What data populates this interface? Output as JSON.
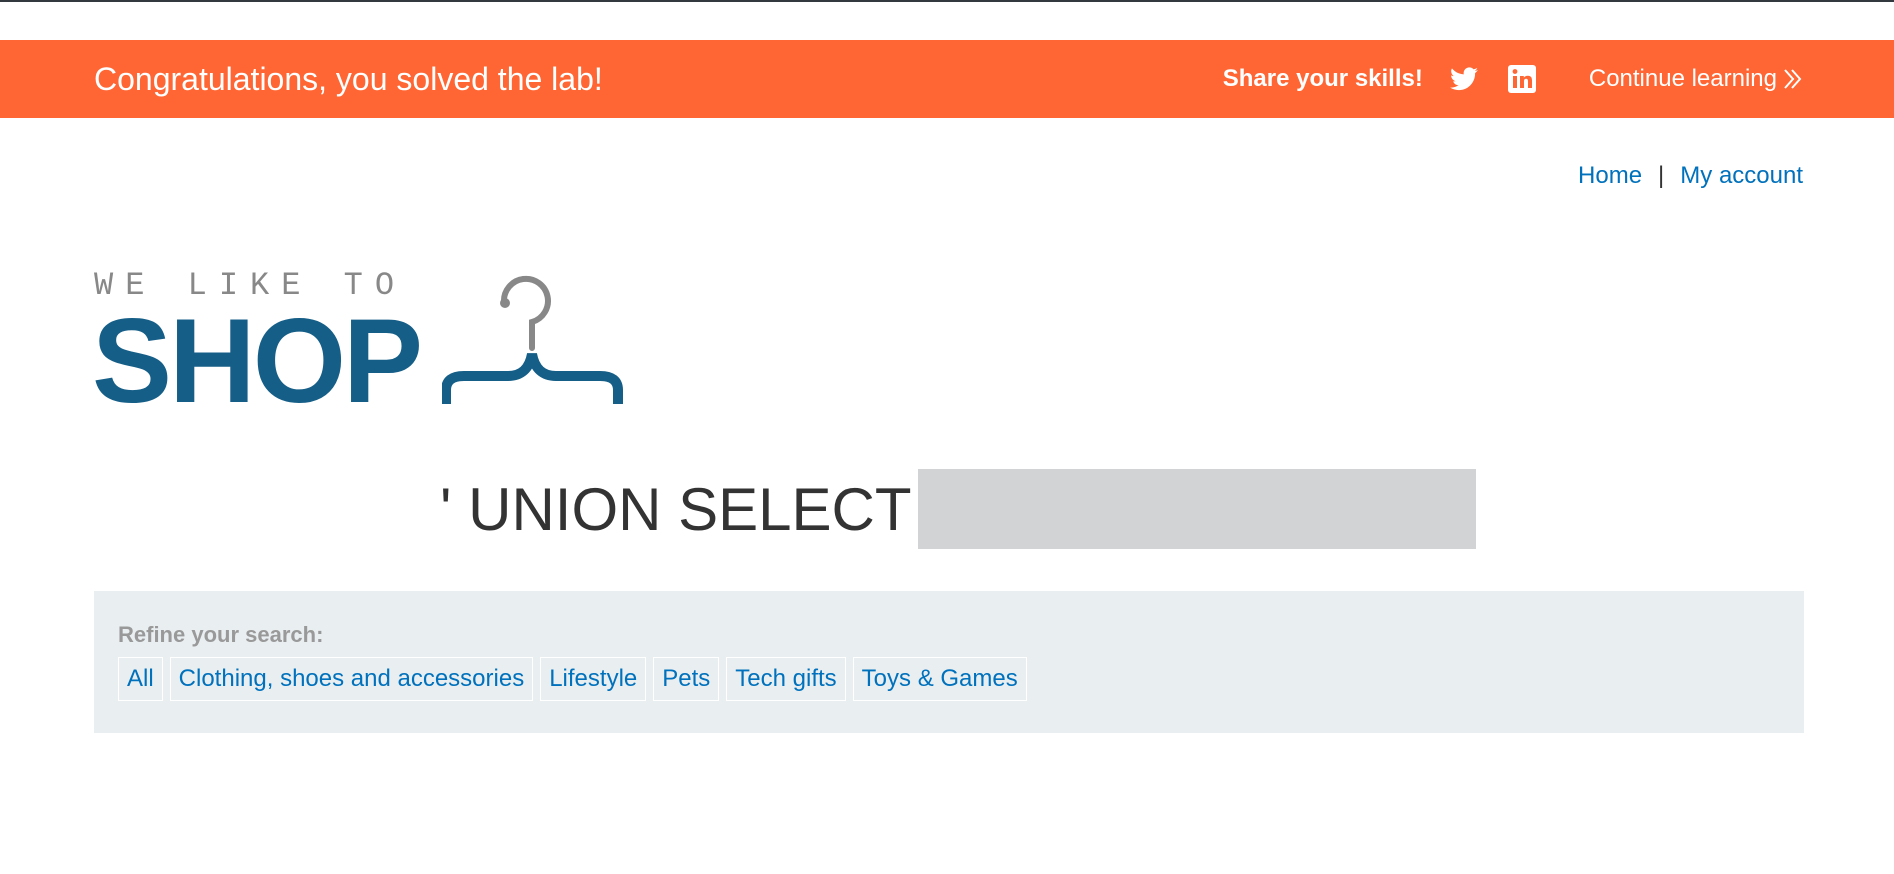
{
  "banner": {
    "title": "Congratulations, you solved the lab!",
    "share_label": "Share your skills!",
    "twitter_icon": "twitter-icon",
    "linkedin_icon": "linkedin-icon",
    "continue_label": "Continue learning",
    "continue_icon": "double-chevron-right-icon",
    "background_color": "#ff6633"
  },
  "nav": {
    "home": "Home",
    "separator": "|",
    "account": "My account",
    "link_color": "#0071bc"
  },
  "logo": {
    "tagline": "WE LIKE TO",
    "word": "SHOP",
    "icon": "hanger-icon",
    "brand_color": "#155e87"
  },
  "search": {
    "heading": "' UNION SELECT"
  },
  "refine": {
    "label": "Refine your search:",
    "filters": [
      "All",
      "Clothing, shoes and accessories",
      "Lifestyle",
      "Pets",
      "Tech gifts",
      "Toys & Games"
    ]
  }
}
